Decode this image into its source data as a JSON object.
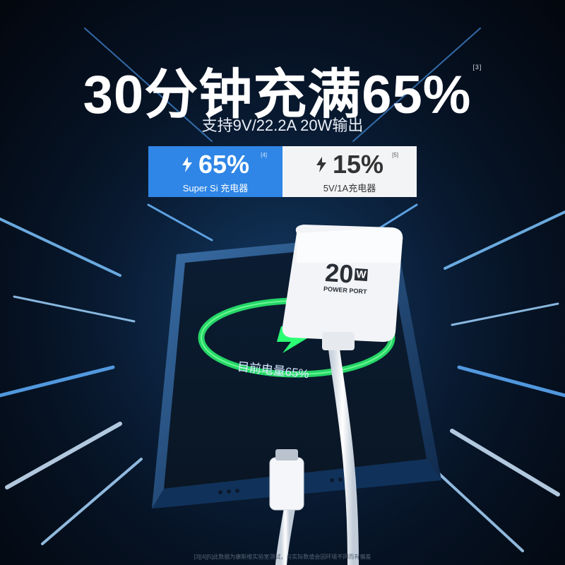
{
  "headline": {
    "text": "30分钟充满65%",
    "ref": "[3]"
  },
  "subtitle": "支持9V/22.2A 20W输出",
  "compare": {
    "left": {
      "percent": "65%",
      "caption": "Super Si 充电器",
      "ref": "[4]",
      "color": "#2f86e6"
    },
    "right": {
      "percent": "15%",
      "caption": "5V/1A充电器",
      "ref": "[5]",
      "color": "#f3f4f6"
    }
  },
  "phone_screen": {
    "text": "目前电量65%"
  },
  "charger": {
    "rating": "20",
    "unit": "W",
    "label": "POWER PORT"
  },
  "footnote": "[3][4][5]此数据为康斯维实验室测试，与实际数值会因环境不同而有偏差"
}
